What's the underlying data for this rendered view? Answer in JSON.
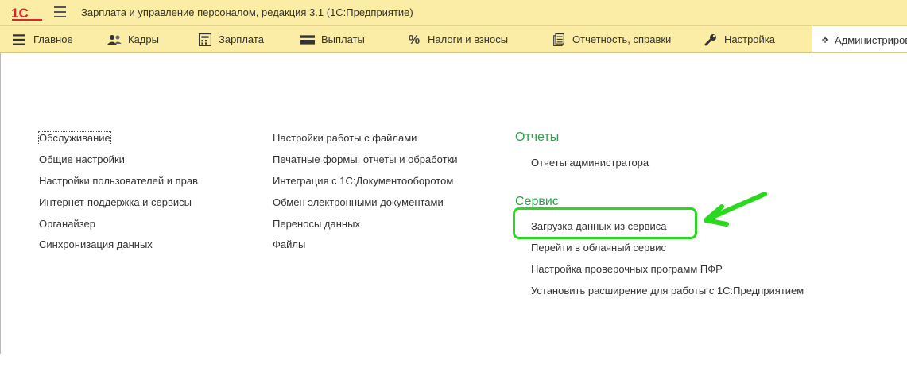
{
  "app": {
    "logo_text": "1С",
    "title": "Зарплата и управление персоналом, редакция 3.1  (1С:Предприятие)"
  },
  "sections": [
    {
      "label": "Главное",
      "icon": "menu-lines-icon"
    },
    {
      "label": "Кадры",
      "icon": "people-icon"
    },
    {
      "label": "Зарплата",
      "icon": "calculator-icon"
    },
    {
      "label": "Выплаты",
      "icon": "wallet-icon"
    },
    {
      "label": "Налоги и взносы",
      "icon": "percent-icon"
    },
    {
      "label": "Отчетность, справки",
      "icon": "document-icon"
    },
    {
      "label": "Настройка",
      "icon": "wrench-icon"
    },
    {
      "label": "Администрирование",
      "icon": "gear-icon",
      "active": true
    }
  ],
  "column1": [
    "Обслуживание",
    "Общие настройки",
    "Настройки пользователей и прав",
    "Интернет-поддержка и сервисы",
    "Органайзер",
    "Синхронизация данных"
  ],
  "column2": [
    "Настройки работы с файлами",
    "Печатные формы, отчеты и обработки",
    "Интеграция с 1С:Документооборотом",
    "Обмен электронными документами",
    "Переносы данных",
    "Файлы"
  ],
  "reports": {
    "title": "Отчеты",
    "items": [
      "Отчеты администратора"
    ]
  },
  "service": {
    "title": "Сервис",
    "items": [
      "Загрузка данных из сервиса",
      "Перейти в облачный сервис",
      "Настройка проверочных программ ПФР",
      "Установить расширение для работы с 1С:Предприятием"
    ]
  },
  "colors": {
    "bar": "#fbeda5",
    "group_title": "#2aa44a",
    "annotation": "#2bd820",
    "logo": "#d7282f"
  }
}
